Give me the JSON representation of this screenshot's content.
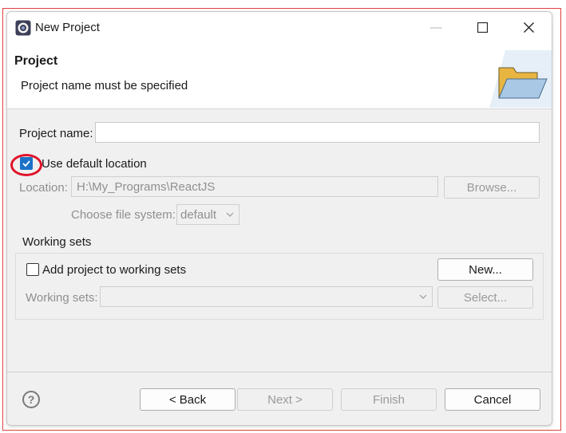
{
  "window": {
    "title": "New Project",
    "minimize_glyph": "—",
    "maximize_glyph": "☐",
    "close_glyph": "✕"
  },
  "header": {
    "title": "Project",
    "message": "Project name must be specified",
    "icon": "folder-open-icon"
  },
  "form": {
    "project_name_label": "Project name:",
    "project_name_value": "",
    "use_default_location_label": "Use default location",
    "use_default_location_checked": true,
    "location_label": "Location:",
    "location_value": "H:\\My_Programs\\ReactJS",
    "browse_label": "Browse...",
    "file_system_label": "Choose file system:",
    "file_system_value": "default"
  },
  "working_sets": {
    "group_title": "Working sets",
    "add_label": "Add project to working sets",
    "add_checked": false,
    "new_label": "New...",
    "sets_label": "Working sets:",
    "sets_value": "",
    "select_label": "Select..."
  },
  "footer": {
    "help_glyph": "?",
    "back_label": "< Back",
    "next_label": "Next >",
    "finish_label": "Finish",
    "cancel_label": "Cancel"
  },
  "colors": {
    "accent": "#1a72c7",
    "highlight": "#e0142a"
  }
}
